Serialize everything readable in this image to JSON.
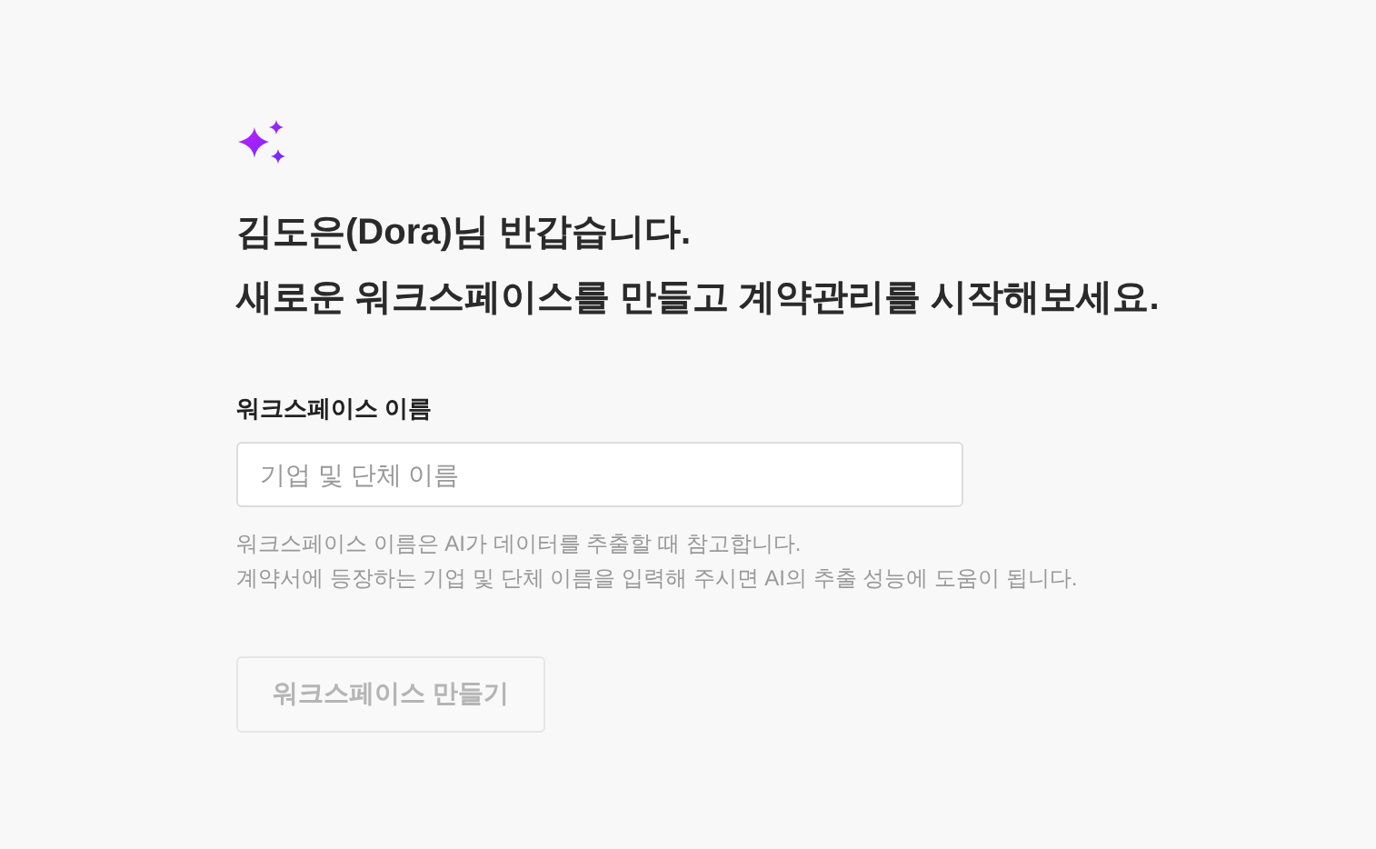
{
  "greeting": [
    "김도은(Dora)님 반갑습니다.",
    "새로운 워크스페이스를 만들고 계약관리를 시작해보세요."
  ],
  "workspace_name": {
    "label": "워크스페이스 이름",
    "placeholder": "기업 및 단체 이름"
  },
  "help": [
    "워크스페이스 이름은 AI가 데이터를 추출할 때 참고합니다.",
    "계약서에 등장하는 기업 및 단체 이름을 입력해 주시면 AI의 추출 성능에 도움이 됩니다."
  ],
  "create_button": {
    "label": "워크스페이스 만들기",
    "disabled": true
  }
}
